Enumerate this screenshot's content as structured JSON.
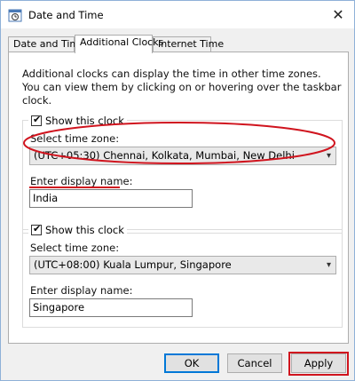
{
  "window": {
    "title": "Date and Time",
    "app_icon": "clock-icon",
    "close_icon": "close-icon"
  },
  "tabs": [
    {
      "label": "Date and Time",
      "active": false
    },
    {
      "label": "Additional Clocks",
      "active": true
    },
    {
      "label": "Internet Time",
      "active": false
    }
  ],
  "intro_text": "Additional clocks can display the time in other time zones. You can view them by clicking on or hovering over the taskbar clock.",
  "clocks": [
    {
      "show_label": "Show this clock",
      "checked": true,
      "timezone_label": "Select time zone:",
      "timezone_value": "(UTC+05:30) Chennai, Kolkata, Mumbai, New Delhi",
      "name_label": "Enter display name:",
      "name_value": "India"
    },
    {
      "show_label": "Show this clock",
      "checked": true,
      "timezone_label": "Select time zone:",
      "timezone_value": "(UTC+08:00) Kuala Lumpur, Singapore",
      "name_label": "Enter display name:",
      "name_value": "Singapore"
    }
  ],
  "buttons": {
    "ok": "OK",
    "cancel": "Cancel",
    "apply": "Apply"
  },
  "colors": {
    "annotation": "#d0141e",
    "focus": "#0078d7"
  }
}
